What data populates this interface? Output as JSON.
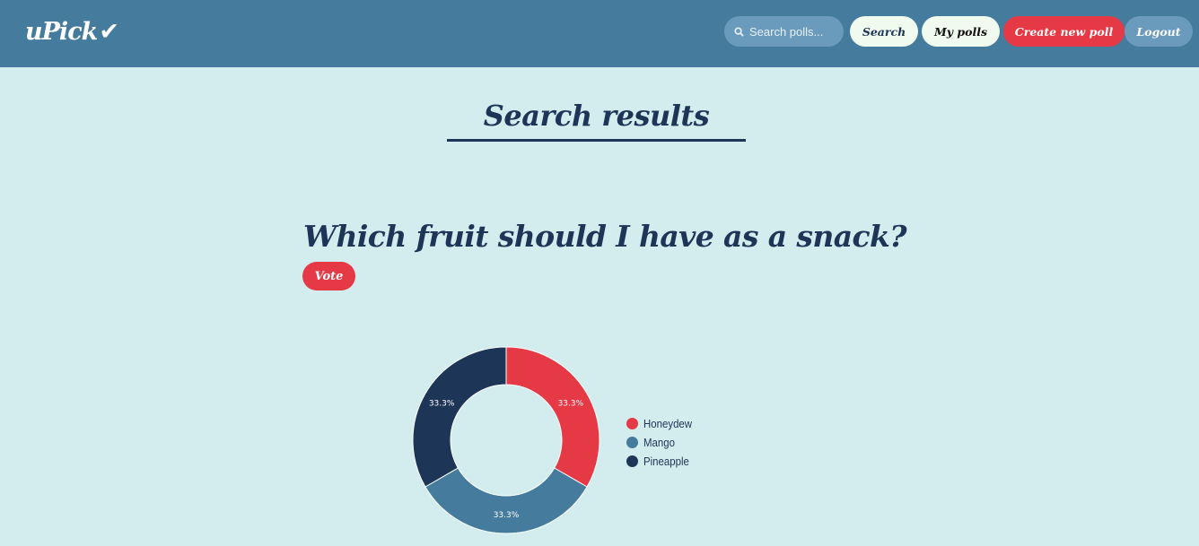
{
  "navbar": {
    "logo_text": "uPick",
    "logo_check": "✔",
    "search": {
      "placeholder": "Search polls...",
      "icon": "search-icon"
    },
    "buttons": {
      "search_label": "Search",
      "my_polls_label": "My polls",
      "create_label": "Create new poll",
      "logout_label": "Logout"
    }
  },
  "main": {
    "title": "Search results",
    "poll": {
      "question": "Which fruit should I have as a snack?",
      "vote_label": "Vote"
    }
  },
  "colors": {
    "navbar": "#457b9d",
    "background": "#d3ecee",
    "accent_red": "#e63946",
    "navy": "#1d3557",
    "steel_blue": "#457b9d"
  },
  "chart_data": {
    "type": "pie",
    "variant": "doughnut",
    "categories": [
      "Honeydew",
      "Mango",
      "Pineapple"
    ],
    "values": [
      33.3,
      33.3,
      33.3
    ],
    "value_labels": [
      "33.3%",
      "33.3%",
      "33.3%"
    ],
    "colors": [
      "#e63946",
      "#457b9d",
      "#1d3557"
    ],
    "legend_position": "right"
  }
}
